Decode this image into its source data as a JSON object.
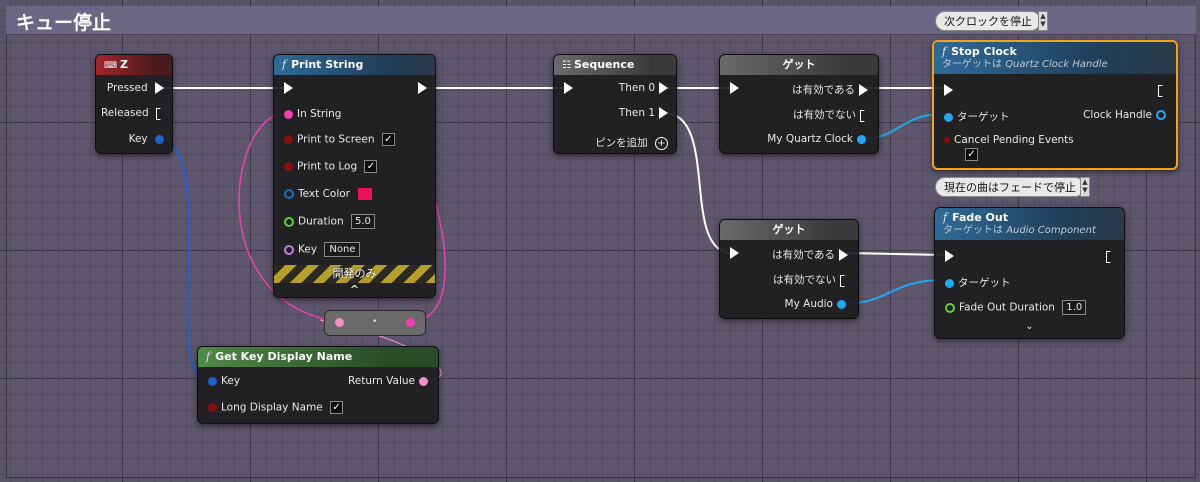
{
  "comment": {
    "title": "キュー停止"
  },
  "nodes": {
    "z_event": {
      "title": "Z",
      "pins": [
        "Pressed",
        "Released",
        "Key"
      ]
    },
    "print_string": {
      "title": "Print String",
      "pins": [
        "In String",
        "Print to Screen",
        "Print to Log",
        "Text Color",
        "Duration",
        "Key"
      ],
      "duration_value": "5.0",
      "key_value": "None",
      "dev_only": "開発のみ",
      "expand_icon": "^"
    },
    "sequence": {
      "title": "Sequence",
      "pins": [
        "Then 0",
        "Then 1"
      ],
      "add_pin": "ピンを追加"
    },
    "get1": {
      "title": "ゲット",
      "pins": [
        "は有効である",
        "は有効でない",
        "My Quartz Clock"
      ]
    },
    "get2": {
      "title": "ゲット",
      "pins": [
        "は有効である",
        "は有効でない",
        "My Audio"
      ]
    },
    "stop_clock": {
      "title": "Stop Clock",
      "subtitle_prefix": "ターゲットは",
      "subtitle_target": "Quartz Clock Handle",
      "pins": [
        "ターゲット",
        "Clock Handle",
        "Cancel Pending Events"
      ],
      "bubble": "次クロックを停止"
    },
    "fade_out": {
      "title": "Fade Out",
      "subtitle_prefix": "ターゲットは",
      "subtitle_target": "Audio Component",
      "pins": [
        "ターゲット",
        "Fade Out Duration"
      ],
      "fade_duration_value": "1.0",
      "bubble": "現在の曲はフェードで停止"
    },
    "get_key_display_name": {
      "title": "Get Key Display Name",
      "pins": [
        "Key",
        "Return Value",
        "Long Display Name"
      ]
    }
  },
  "colors": {
    "exec": "#ffffff",
    "object_pin": "#20a8f0",
    "key_pin": "#2060d0",
    "string_pin": "#f040b0",
    "bool_pin": "#8a1010",
    "float_pin": "#60d040",
    "selection": "#f0a41e"
  }
}
